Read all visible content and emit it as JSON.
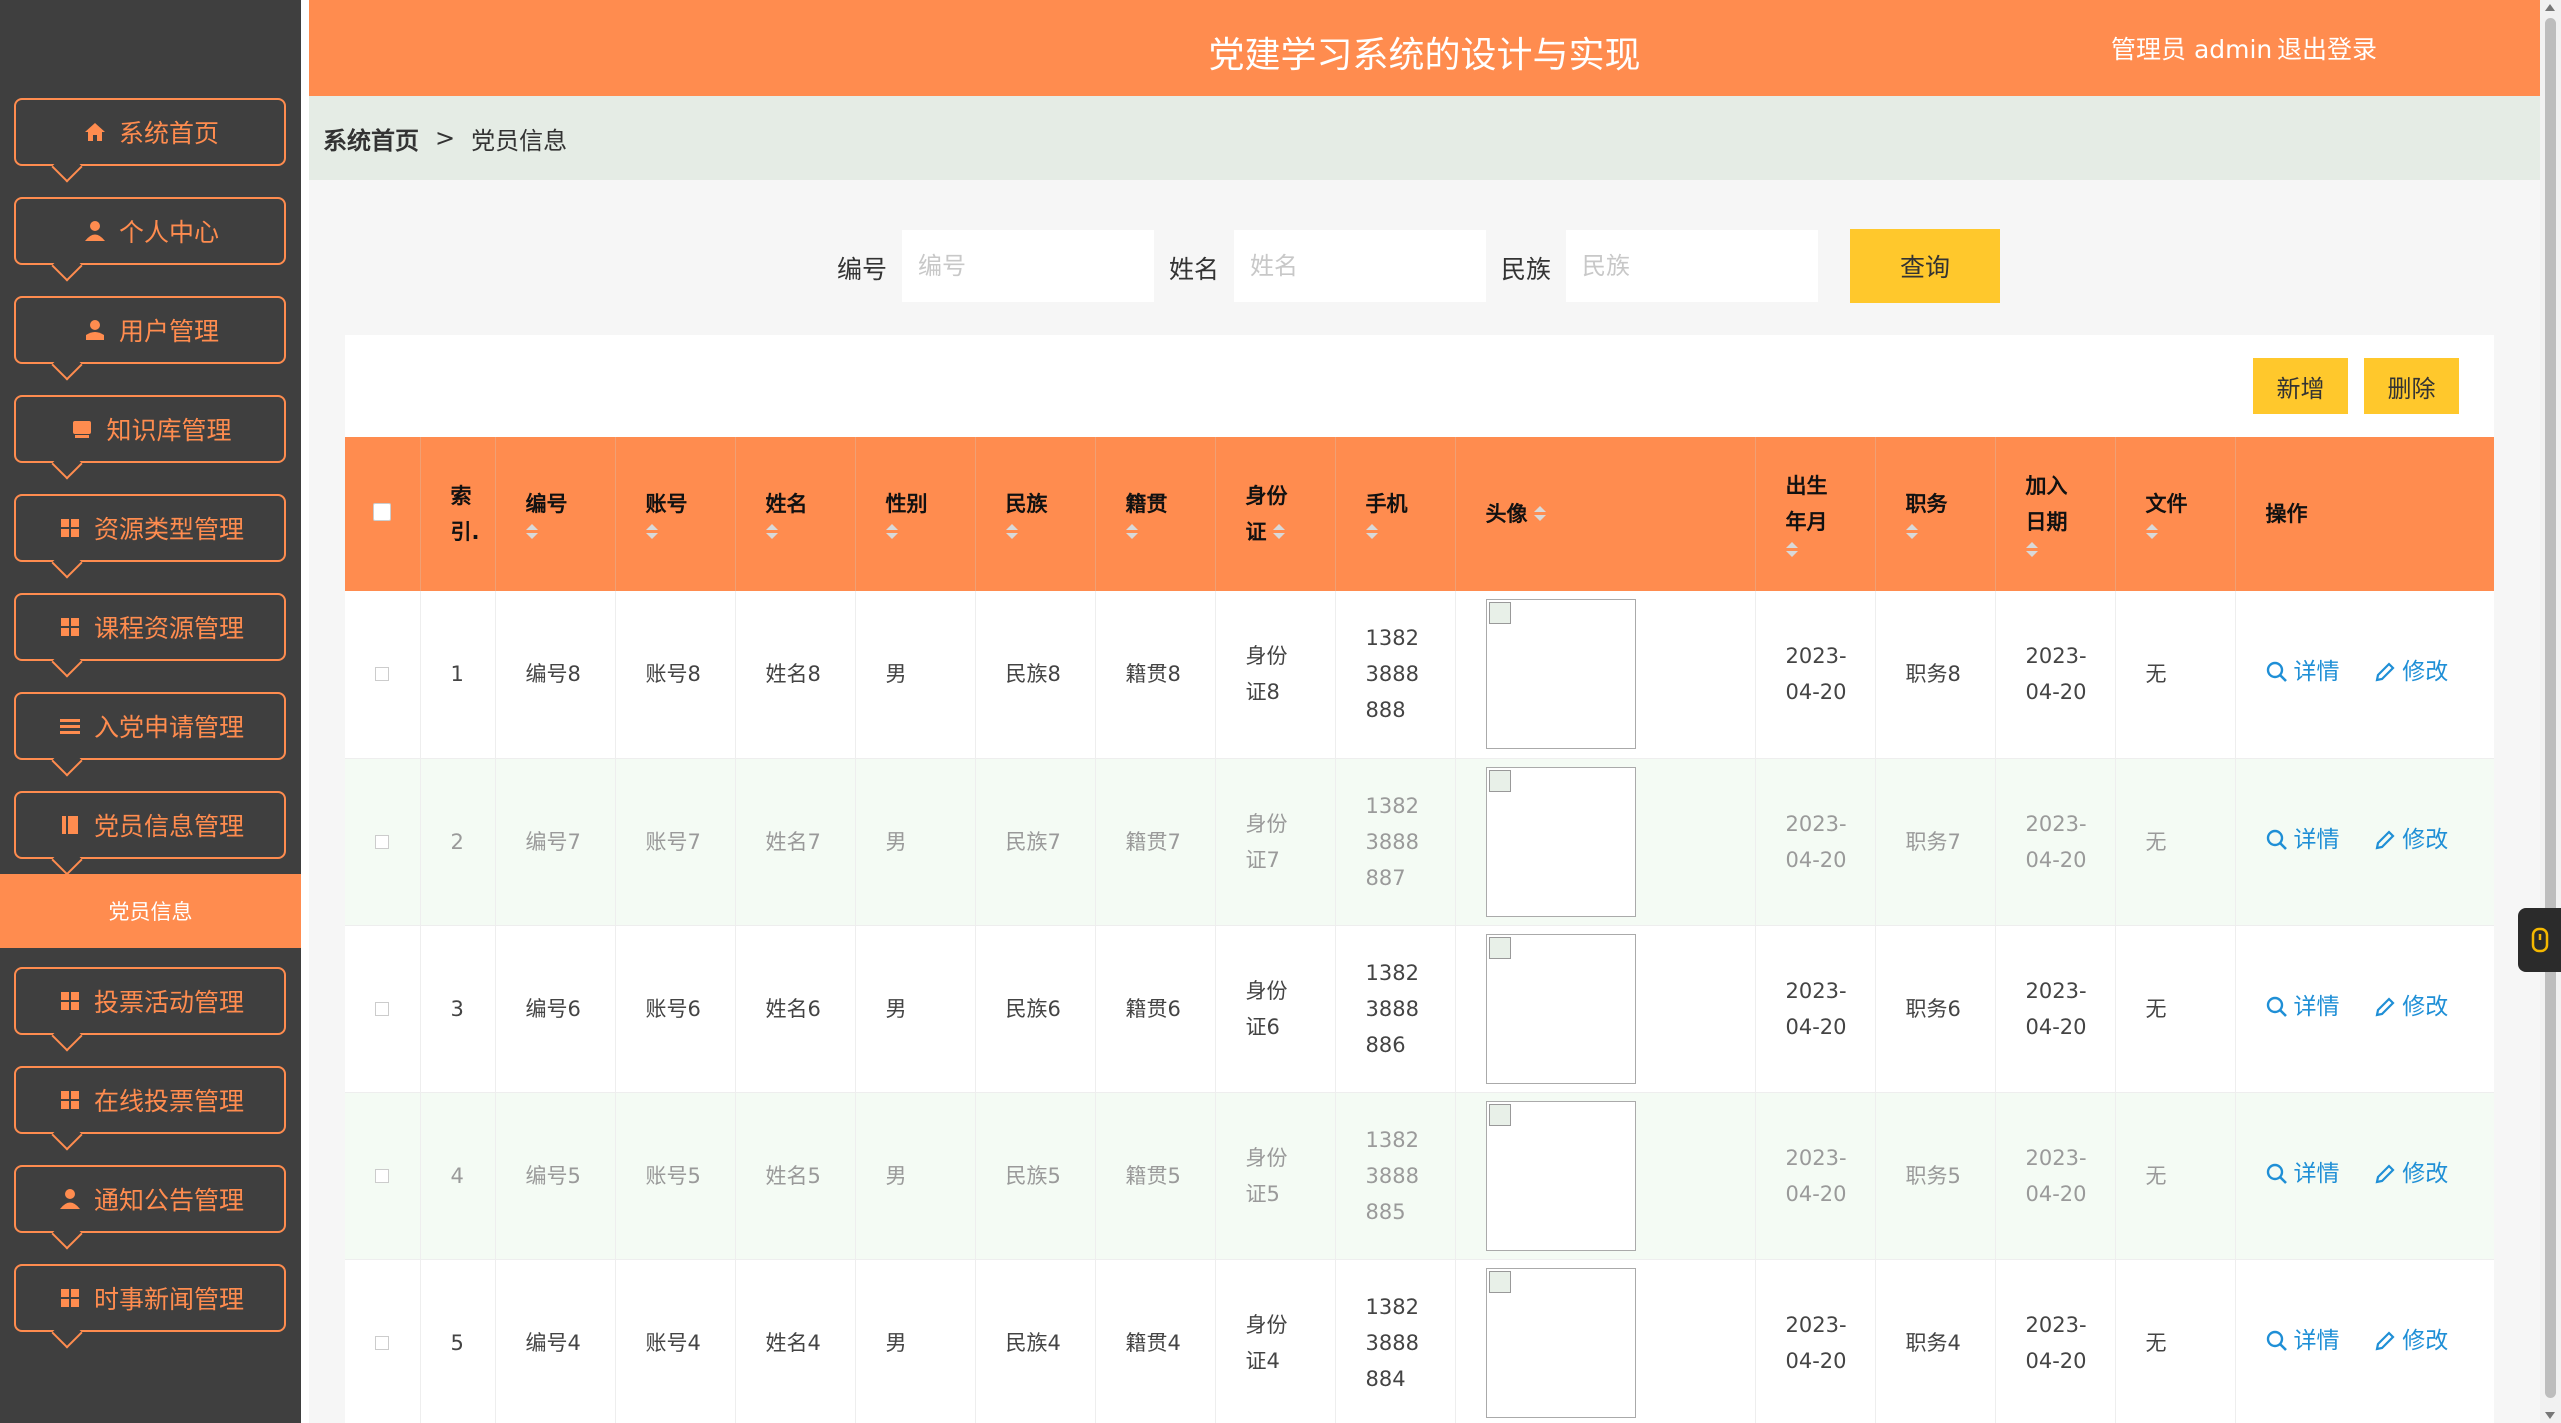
{
  "sidebar": {
    "items": [
      {
        "label": "系统首页",
        "icon": "home-icon"
      },
      {
        "label": "个人中心",
        "icon": "user-icon"
      },
      {
        "label": "用户管理",
        "icon": "user-icon"
      },
      {
        "label": "知识库管理",
        "icon": "book-icon"
      },
      {
        "label": "资源类型管理",
        "icon": "grid-icon"
      },
      {
        "label": "课程资源管理",
        "icon": "grid-icon"
      },
      {
        "label": "入党申请管理",
        "icon": "list-icon"
      },
      {
        "label": "党员信息管理",
        "icon": "book-icon"
      },
      {
        "label": "投票活动管理",
        "icon": "grid-icon"
      },
      {
        "label": "在线投票管理",
        "icon": "grid-icon"
      },
      {
        "label": "通知公告管理",
        "icon": "user-icon"
      },
      {
        "label": "时事新闻管理",
        "icon": "grid-icon"
      }
    ],
    "active_sub": "党员信息"
  },
  "header": {
    "title": "党建学习系统的设计与实现",
    "admin": "管理员 admin",
    "logout": "退出登录"
  },
  "breadcrumb": {
    "home": "系统首页",
    "sep": ">",
    "current": "党员信息"
  },
  "search": {
    "labels": [
      "编号",
      "姓名",
      "民族"
    ],
    "placeholders": [
      "编号",
      "姓名",
      "民族"
    ],
    "query": "查询"
  },
  "actions": {
    "add": "新增",
    "del": "删除"
  },
  "table": {
    "headers": {
      "index": [
        "索",
        "引."
      ],
      "code": "编号",
      "account": "账号",
      "name": "姓名",
      "gender": "性别",
      "ethnic": "民族",
      "origin": "籍贯",
      "idcard": [
        "身份",
        "证"
      ],
      "phone": "手机",
      "avatar": "头像",
      "birth": [
        "出生",
        "年月"
      ],
      "duty": "职务",
      "join": [
        "加入",
        "日期"
      ],
      "file": "文件",
      "op": "操作"
    },
    "rows": [
      {
        "index": "1",
        "code": "编号8",
        "account": "账号8",
        "name": "姓名8",
        "gender": "男",
        "ethnic": "民族8",
        "origin": "籍贯8",
        "idcard": [
          "身份",
          "证8"
        ],
        "phone": [
          "1382",
          "3888",
          "888"
        ],
        "birth": [
          "2023-",
          "04-20"
        ],
        "duty": "职务8",
        "join": [
          "2023-",
          "04-20"
        ],
        "file": "无",
        "detail": "详情",
        "edit": "修改"
      },
      {
        "index": "2",
        "code": "编号7",
        "account": "账号7",
        "name": "姓名7",
        "gender": "男",
        "ethnic": "民族7",
        "origin": "籍贯7",
        "idcard": [
          "身份",
          "证7"
        ],
        "phone": [
          "1382",
          "3888",
          "887"
        ],
        "birth": [
          "2023-",
          "04-20"
        ],
        "duty": "职务7",
        "join": [
          "2023-",
          "04-20"
        ],
        "file": "无",
        "detail": "详情",
        "edit": "修改"
      },
      {
        "index": "3",
        "code": "编号6",
        "account": "账号6",
        "name": "姓名6",
        "gender": "男",
        "ethnic": "民族6",
        "origin": "籍贯6",
        "idcard": [
          "身份",
          "证6"
        ],
        "phone": [
          "1382",
          "3888",
          "886"
        ],
        "birth": [
          "2023-",
          "04-20"
        ],
        "duty": "职务6",
        "join": [
          "2023-",
          "04-20"
        ],
        "file": "无",
        "detail": "详情",
        "edit": "修改"
      },
      {
        "index": "4",
        "code": "编号5",
        "account": "账号5",
        "name": "姓名5",
        "gender": "男",
        "ethnic": "民族5",
        "origin": "籍贯5",
        "idcard": [
          "身份",
          "证5"
        ],
        "phone": [
          "1382",
          "3888",
          "885"
        ],
        "birth": [
          "2023-",
          "04-20"
        ],
        "duty": "职务5",
        "join": [
          "2023-",
          "04-20"
        ],
        "file": "无",
        "detail": "详情",
        "edit": "修改"
      },
      {
        "index": "5",
        "code": "编号4",
        "account": "账号4",
        "name": "姓名4",
        "gender": "男",
        "ethnic": "民族4",
        "origin": "籍贯4",
        "idcard": [
          "身份",
          "证4"
        ],
        "phone": [
          "1382",
          "3888",
          "884"
        ],
        "birth": [
          "2023-",
          "04-20"
        ],
        "duty": "职务4",
        "join": [
          "2023-",
          "04-20"
        ],
        "file": "无",
        "detail": "详情",
        "edit": "修改"
      }
    ]
  },
  "colors": {
    "accent": "#ff8c4f",
    "sidebar": "#3f3f3f",
    "button": "#ffc82c",
    "link": "#1f8fd6"
  }
}
